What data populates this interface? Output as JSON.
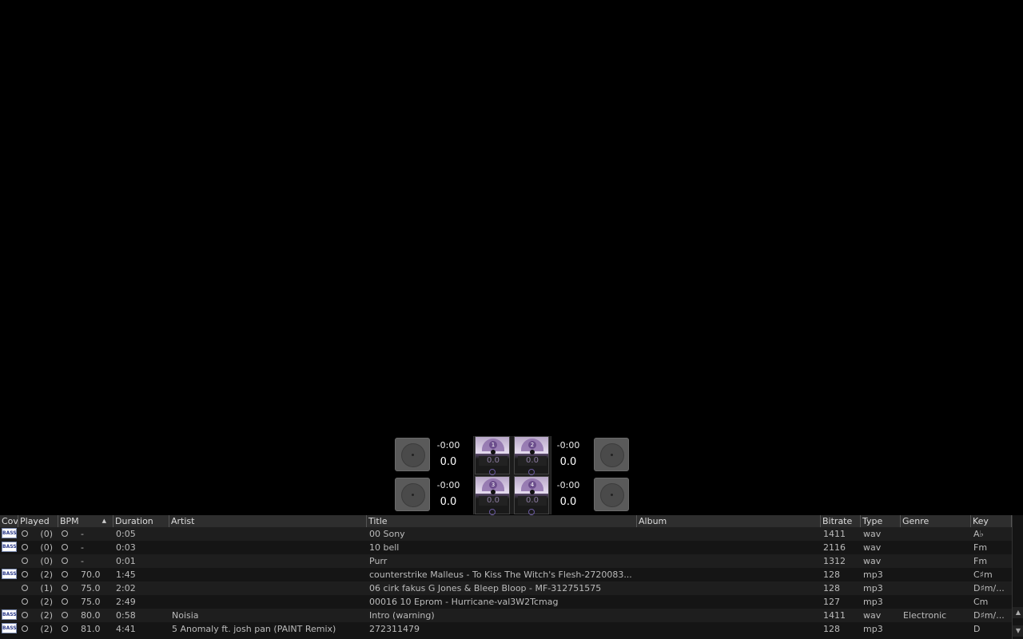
{
  "decks": [
    {
      "remaining": "-0:00",
      "bpm": "0.0"
    },
    {
      "remaining": "-0:00",
      "bpm": "0.0"
    },
    {
      "remaining": "-0:00",
      "bpm": "0.0"
    },
    {
      "remaining": "-0:00",
      "bpm": "0.0"
    }
  ],
  "vu": [
    {
      "num": "1",
      "value": "0.0"
    },
    {
      "num": "2",
      "value": "0.0"
    },
    {
      "num": "3",
      "value": "0.0"
    },
    {
      "num": "4",
      "value": "0.0"
    }
  ],
  "library": {
    "columns": [
      "Cov",
      "Played",
      "BPM",
      "Duration",
      "Artist",
      "Title",
      "Album",
      "Bitrate",
      "Type",
      "Genre",
      "Key"
    ],
    "cover_text": "BASS",
    "rows": [
      {
        "cover": true,
        "played": "(0)",
        "bpm": "-",
        "duration": "0:05",
        "artist": "",
        "title": "00 Sony",
        "album": "",
        "bitrate": "1411",
        "type": "wav",
        "genre": "",
        "key": "A♭"
      },
      {
        "cover": true,
        "played": "(0)",
        "bpm": "-",
        "duration": "0:03",
        "artist": "",
        "title": "10 bell",
        "album": "",
        "bitrate": "2116",
        "type": "wav",
        "genre": "",
        "key": "Fm"
      },
      {
        "cover": false,
        "played": "(0)",
        "bpm": "-",
        "duration": "0:01",
        "artist": "",
        "title": "Purr",
        "album": "",
        "bitrate": "1312",
        "type": "wav",
        "genre": "",
        "key": "Fm"
      },
      {
        "cover": true,
        "played": "(2)",
        "bpm": "70.0",
        "duration": "1:45",
        "artist": "",
        "title": "counterstrike Malleus - To Kiss The Witch's Flesh-2720083...",
        "album": "",
        "bitrate": "128",
        "type": "mp3",
        "genre": "",
        "key": "C♯m"
      },
      {
        "cover": false,
        "played": "(1)",
        "bpm": "75.0",
        "duration": "2:02",
        "artist": "",
        "title": "06 cirk fakus G Jones & Bleep Bloop - MF-312751575",
        "album": "",
        "bitrate": "128",
        "type": "mp3",
        "genre": "",
        "key": "D♯m/..."
      },
      {
        "cover": false,
        "played": "(2)",
        "bpm": "75.0",
        "duration": "2:49",
        "artist": "",
        "title": "00016 10 Eprom - Hurricane-val3W2Tcmag",
        "album": "",
        "bitrate": "127",
        "type": "mp3",
        "genre": "",
        "key": "Cm"
      },
      {
        "cover": true,
        "played": "(2)",
        "bpm": "80.0",
        "duration": "0:58",
        "artist": "Noisia",
        "title": "Intro (warning)",
        "album": "",
        "bitrate": "1411",
        "type": "wav",
        "genre": "Electronic",
        "key": "D♯m/..."
      },
      {
        "cover": true,
        "played": "(2)",
        "bpm": "81.0",
        "duration": "4:41",
        "artist": "5 Anomaly ft. josh pan (PAINT Remix)",
        "title": "272311479",
        "album": "",
        "bitrate": "128",
        "type": "mp3",
        "genre": "",
        "key": "D"
      }
    ]
  },
  "scroll": {
    "up": "▲",
    "down": "▼"
  },
  "sort_indicator": "▲"
}
